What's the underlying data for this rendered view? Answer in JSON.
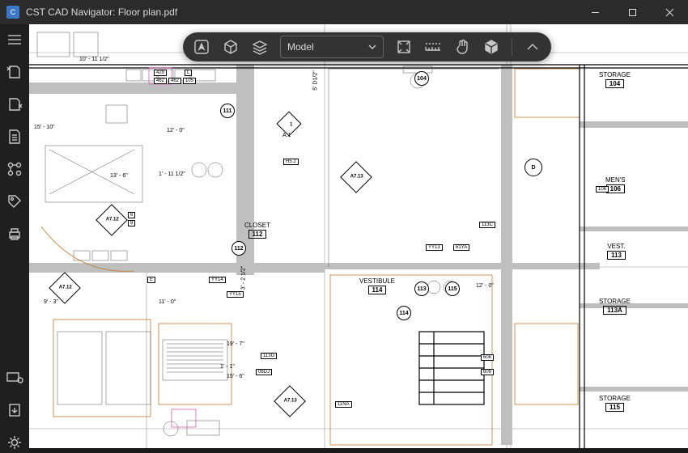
{
  "titlebar": {
    "app_initial": "C",
    "title": "CST CAD Navigator: Floor plan.pdf"
  },
  "floatbar": {
    "combo_label": "Model"
  },
  "rooms": {
    "storage_104": {
      "name": "STORAGE",
      "num": "104"
    },
    "mens_106": {
      "name": "MEN'S",
      "num": "106"
    },
    "vest_113": {
      "name": "VEST.",
      "num": "113"
    },
    "storage_113a": {
      "name": "STORAGE",
      "num": "113A"
    },
    "storage_115": {
      "name": "STORAGE",
      "num": "115"
    },
    "closet_112": {
      "name": "CLOSET",
      "num": "112"
    },
    "vestibule_114": {
      "name": "VESTIBULE",
      "num": "114"
    }
  },
  "bubbles": {
    "b104": "104",
    "b111": "111",
    "b113": "113",
    "b114": "114",
    "b115": "115",
    "b112": "112",
    "d": "D"
  },
  "diamonds": {
    "a712_1": "A7.12",
    "a712_2": "A7.12",
    "a713_1": "A7.13",
    "a713_2": "A7.13",
    "one_a1": "1"
  },
  "small_notes": {
    "one_a1_sub": "A.1",
    "d6": "6",
    "b8": "8",
    "e": "E"
  },
  "dims": {
    "d1": "10' - 11 1/2\"",
    "d2": "15' - 10\"",
    "d3": "12' - 0\"",
    "d4": "1' - 11 1/2\"",
    "d5": "13' - 6\"",
    "d6": "1' - 1\"",
    "d7": "5' D1/2\"",
    "d8": "3' - 2 1/2\"",
    "d9": "12' - 0\"",
    "d10": "19' - 7\"",
    "d11": "11' - 0\"",
    "d12": "15' - 6\"",
    "d13": "9' - 3\""
  },
  "tags": {
    "t429": "429",
    "t462_1": "462",
    "t462_2": "462",
    "t105": "105",
    "tL": "L",
    "tH52": "H5.2",
    "t106": "106",
    "t11NA": "11NA",
    "t06DJ": "06DJ",
    "t113G": "113G",
    "t113C": "113C",
    "tYY14": "YY14",
    "tYY15": "YY15",
    "t61YA": "61YA",
    "tYY13": "YY13",
    "t608": "608",
    "t609": "609"
  },
  "sidebar_items": [
    "menu",
    "open",
    "save",
    "document",
    "nodes",
    "labels",
    "print",
    "view",
    "export",
    "settings"
  ]
}
